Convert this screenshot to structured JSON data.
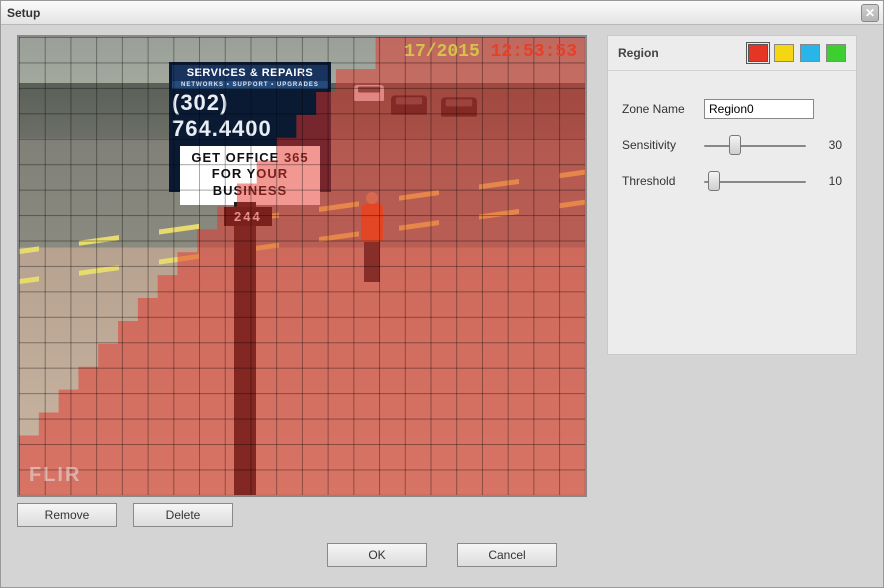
{
  "window": {
    "title": "Setup"
  },
  "video": {
    "timestamp_date": "17/2015",
    "timestamp_time": " 12:53:53",
    "watermark": "FLIR",
    "sign": {
      "headline": "SERVICES & REPAIRS",
      "subline": "NETWORKS • SUPPORT • UPGRADES",
      "phone": "(302) 764.4400",
      "marquee1": "GET OFFICE 365",
      "marquee2": "FOR YOUR BUSINESS",
      "address": "244"
    }
  },
  "grid_buttons": {
    "remove": "Remove",
    "delete": "Delete"
  },
  "panel": {
    "title": "Region",
    "colors": [
      {
        "name": "red",
        "hex": "#e53525",
        "active": true
      },
      {
        "name": "yellow",
        "hex": "#f4d712",
        "active": false
      },
      {
        "name": "cyan",
        "hex": "#29b5e8",
        "active": false
      },
      {
        "name": "green",
        "hex": "#3ccf2f",
        "active": false
      }
    ],
    "zone_name_label": "Zone Name",
    "zone_name_value": "Region0",
    "sensitivity_label": "Sensitivity",
    "sensitivity_value": 30,
    "sensitivity_min": 0,
    "sensitivity_max": 100,
    "threshold_label": "Threshold",
    "threshold_value": 10,
    "threshold_min": 0,
    "threshold_max": 100
  },
  "footer": {
    "ok": "OK",
    "cancel": "Cancel"
  }
}
